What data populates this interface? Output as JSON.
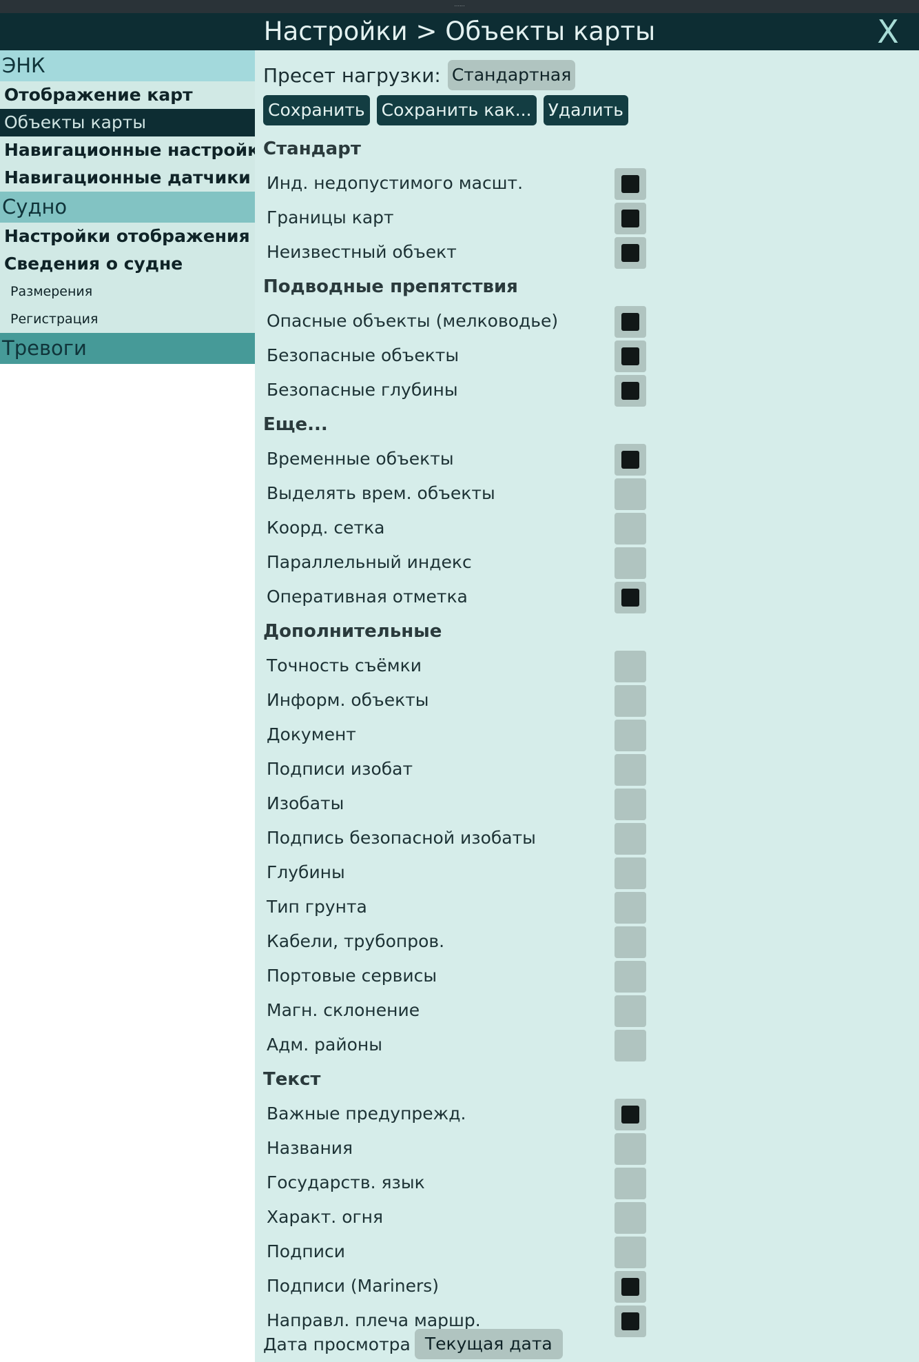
{
  "window": {
    "grip_text": "......",
    "title": "Настройки > Объекты карты",
    "close_label": "X"
  },
  "sidebar": {
    "sections": [
      {
        "title": "ЭНК",
        "items": [
          {
            "label": "Отображение карт",
            "active": false
          },
          {
            "label": "Объекты карты",
            "active": true
          },
          {
            "label": "Навигационные настройки",
            "active": false
          },
          {
            "label": "Навигационные датчики",
            "active": false
          }
        ]
      },
      {
        "title": "Судно",
        "items": [
          {
            "label": "Настройки отображения"
          },
          {
            "label": "Сведения о судне"
          }
        ],
        "subitems": [
          {
            "label": "Размерения"
          },
          {
            "label": "Регистрация"
          }
        ]
      },
      {
        "title": "Тревоги"
      }
    ]
  },
  "main": {
    "preset_label": "Пресет нагрузки:",
    "preset_value": "Стандартная",
    "buttons": {
      "save": "Сохранить",
      "save_as": "Сохранить как...",
      "delete": "Удалить"
    },
    "groups": [
      {
        "title": "Стандарт",
        "items": [
          {
            "label": "Инд. недопустимого масшт.",
            "checked": true
          },
          {
            "label": "Границы карт",
            "checked": true
          },
          {
            "label": "Неизвестный объект",
            "checked": true
          }
        ]
      },
      {
        "title": "Подводные препятствия",
        "items": [
          {
            "label": "Опасные объекты (мелководье)",
            "checked": true
          },
          {
            "label": "Безопасные объекты",
            "checked": true
          },
          {
            "label": "Безопасные глубины",
            "checked": true
          }
        ]
      },
      {
        "title": "Еще...",
        "items": [
          {
            "label": "Временные объекты",
            "checked": true
          },
          {
            "label": "Выделять врем. объекты",
            "checked": false
          },
          {
            "label": "Коорд. сетка",
            "checked": false
          },
          {
            "label": "Параллельный индекс",
            "checked": false
          },
          {
            "label": "Оперативная отметка",
            "checked": true
          }
        ]
      },
      {
        "title": "Дополнительные",
        "items": [
          {
            "label": "Точность съёмки",
            "checked": false
          },
          {
            "label": "Информ. объекты",
            "checked": false
          },
          {
            "label": "Документ",
            "checked": false
          },
          {
            "label": "Подписи изобат",
            "checked": false
          },
          {
            "label": "Изобаты",
            "checked": false
          },
          {
            "label": "Подпись безопасной изобаты",
            "checked": false
          },
          {
            "label": "Глубины",
            "checked": false
          },
          {
            "label": "Тип грунта",
            "checked": false
          },
          {
            "label": "Кабели, трубопров.",
            "checked": false
          },
          {
            "label": "Портовые сервисы",
            "checked": false
          },
          {
            "label": "Магн. склонение",
            "checked": false
          },
          {
            "label": "Адм. районы",
            "checked": false
          }
        ]
      },
      {
        "title": "Текст",
        "items": [
          {
            "label": "Важные предупрежд.",
            "checked": true
          },
          {
            "label": "Названия",
            "checked": false
          },
          {
            "label": "Государств. язык",
            "checked": false
          },
          {
            "label": "Характ. огня",
            "checked": false
          },
          {
            "label": "Подписи",
            "checked": false
          },
          {
            "label": "Подписи (Mariners)",
            "checked": true
          },
          {
            "label": "Направл. плеча маршр.",
            "checked": true
          }
        ]
      }
    ],
    "view_date_label": "Дата просмотра",
    "view_date_value": "Текущая дата"
  },
  "colors": {
    "titlebar": "#0d2d33",
    "sidebar_item_bg": "#d1e9e5",
    "main_bg": "#d6edea",
    "button_bg": "#133d42",
    "checkbox_bg": "#b0c4c0",
    "checkbox_mark": "#111717"
  }
}
